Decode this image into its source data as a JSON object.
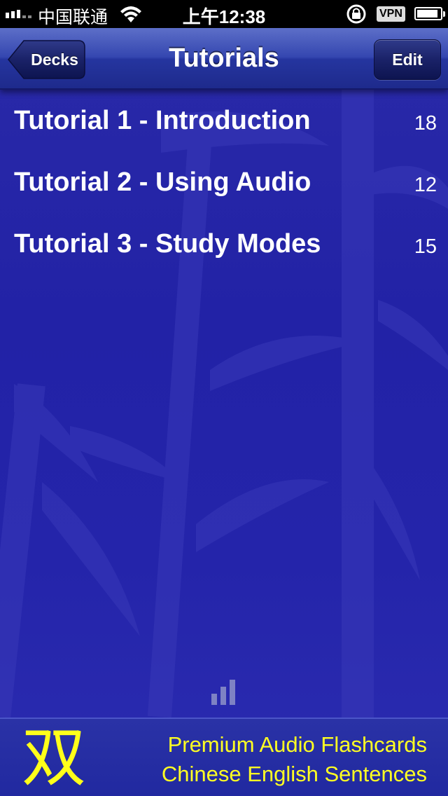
{
  "status_bar": {
    "carrier": "中国联通",
    "time": "上午12:38",
    "vpn_label": "VPN",
    "battery_level": 0.85,
    "icons": [
      "signal-icon",
      "wifi-icon",
      "rotation-lock-icon",
      "battery-icon"
    ]
  },
  "nav": {
    "back_label": "Decks",
    "title": "Tutorials",
    "edit_label": "Edit"
  },
  "tutorials": [
    {
      "title": "Tutorial 1 - Introduction",
      "count": "18"
    },
    {
      "title": "Tutorial 2 - Using Audio",
      "count": "12"
    },
    {
      "title": "Tutorial 3 - Study Modes",
      "count": "15"
    }
  ],
  "footer": {
    "logo_char": "双",
    "line1": "Premium Audio Flashcards",
    "line2": "Chinese English Sentences"
  },
  "colors": {
    "background": "#2424aa",
    "footer_text": "#ffff22",
    "text": "#ffffff"
  }
}
